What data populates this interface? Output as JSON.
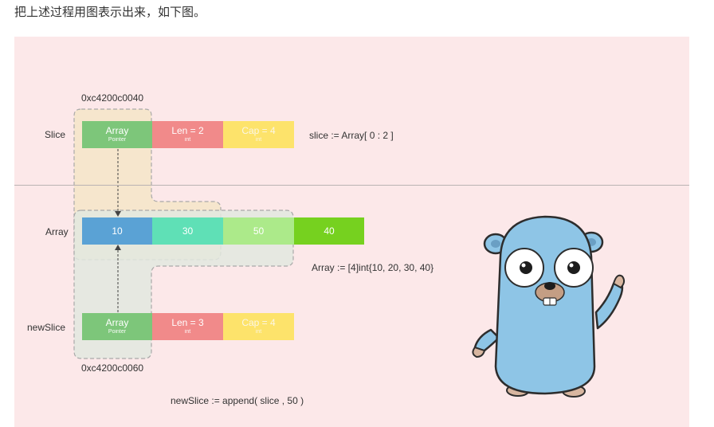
{
  "intro_text": "把上述过程用图表示出来，如下图。",
  "diagram": {
    "slice_address": "0xc4200c0040",
    "newslice_address": "0xc4200c0060",
    "row_labels": {
      "slice": "Slice",
      "array": "Array",
      "newslice": "newSlice"
    },
    "slice_cells": {
      "array_label": "Array",
      "array_sub": "Pointer",
      "len_label": "Len = 2",
      "len_sub": "int",
      "cap_label": "Cap = 4",
      "cap_sub": "int"
    },
    "newslice_cells": {
      "array_label": "Array",
      "array_sub": "Pointer",
      "len_label": "Len = 3",
      "len_sub": "int",
      "cap_label": "Cap = 4",
      "cap_sub": "int"
    },
    "array_values": [
      "10",
      "30",
      "50",
      "40"
    ],
    "code_slice": "slice := Array[ 0 : 2 ]",
    "code_array": "Array := [4]int{10, 20, 30, 40}",
    "code_append": "newSlice := append( slice , 50 )"
  },
  "mascot": {
    "name": "gopher-mascot",
    "body_color": "#8ec5e6",
    "nose_color": "#c49e84",
    "paw_color": "#d8b6a0"
  },
  "colors": {
    "background": "#fce8e9",
    "green": "#7dc67a",
    "red": "#f18a8a",
    "yellow": "#fde36b",
    "blue": "#5aa2d5",
    "teal": "#5fe0b6",
    "light_green": "#acea8a",
    "bright_green": "#76d11f",
    "slice_highlight": "#f6e4c6",
    "newslice_highlight": "#e2e8df"
  }
}
